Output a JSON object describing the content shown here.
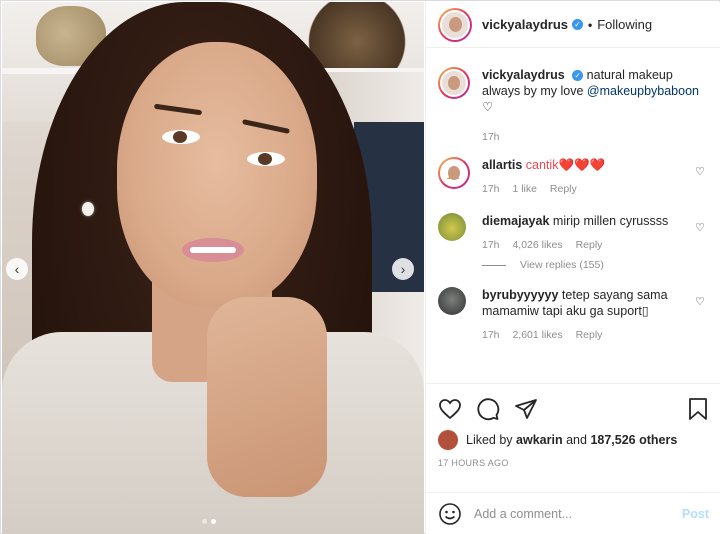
{
  "post": {
    "username": "vickyalaydrus",
    "follow_status": "Following",
    "separator": "•"
  },
  "caption": {
    "username": "vickyalaydrus",
    "text": "natural makeup always by my love",
    "mention": "@makeupbybaboon",
    "heart": "♡",
    "time": "17h"
  },
  "comments": [
    {
      "username": "allartis",
      "text": "cantik❤️❤️❤️",
      "time": "17h",
      "likes": "1 like",
      "reply": "Reply"
    },
    {
      "username": "diemajayak",
      "text": "mirip millen cyrussss",
      "time": "17h",
      "likes": "4,026 likes",
      "reply": "Reply",
      "view_replies": "View replies (155)"
    },
    {
      "username": "byrubyyyyyy",
      "text": "tetep sayang sama mamamiw tapi aku ga suport▯",
      "time": "17h",
      "likes": "2,601 likes",
      "reply": "Reply"
    }
  ],
  "likes": {
    "prefix": "Liked by",
    "user": "awkarin",
    "suffix": "and",
    "count": "187,526 others"
  },
  "timestamp": "17 HOURS AGO",
  "add_comment": {
    "placeholder": "Add a comment...",
    "post_label": "Post"
  },
  "icons": {
    "like": "heart-icon",
    "comment": "comment-icon",
    "share": "share-icon",
    "save": "bookmark-icon",
    "emoji": "emoji-icon"
  },
  "colors": {
    "verified": "#3897f0",
    "mention": "#00376b",
    "post_disabled": "#b2dffc",
    "heart_red": "#ed4956"
  },
  "carousel": {
    "slides": 2,
    "active": 2
  }
}
